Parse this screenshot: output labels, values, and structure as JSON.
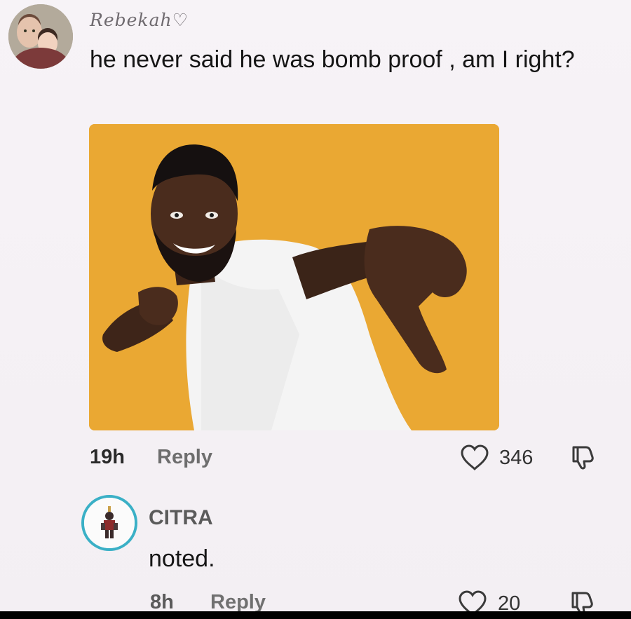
{
  "comment": {
    "username": "Rebekah♡",
    "text": "he never said he was bomb proof , am I right?",
    "time": "19h",
    "reply_label": "Reply",
    "like_count": "346",
    "avatar_icon": "profile-photo",
    "image_icon": "pointing-man-photo"
  },
  "reply_comment": {
    "username": "CITRA",
    "text": "noted.",
    "time": "8h",
    "reply_label": "Reply",
    "like_count": "20",
    "avatar_icon": "character-avatar",
    "avatar_ring_color": "#3ab0c6"
  },
  "icons": {
    "like": "heart-outline-icon",
    "dislike": "thumbs-down-icon"
  },
  "colors": {
    "background": "#f6f2f6",
    "image_background": "#e9a732"
  }
}
